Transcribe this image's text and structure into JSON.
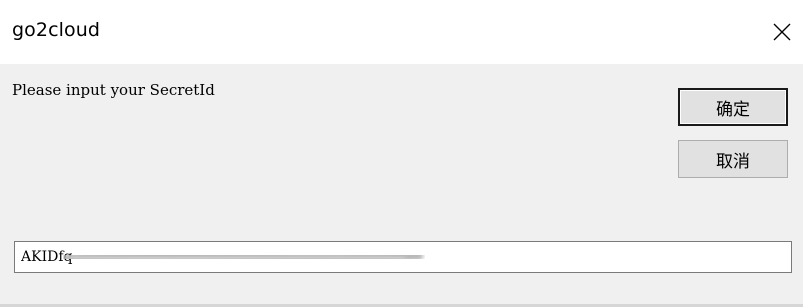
{
  "window": {
    "title": "go2cloud",
    "close_icon": "close-icon"
  },
  "prompt": {
    "text": "Please input your SecretId"
  },
  "buttons": {
    "ok_label": "确定",
    "cancel_label": "取消"
  },
  "secret_input": {
    "value": "AKIDfq"
  },
  "colors": {
    "titlebar": "#ffffff",
    "dialog_bg": "#f0f0f0",
    "button_bg": "#e1e1e1",
    "button_border": "#adadad",
    "default_button_border": "#1a1a1a"
  }
}
